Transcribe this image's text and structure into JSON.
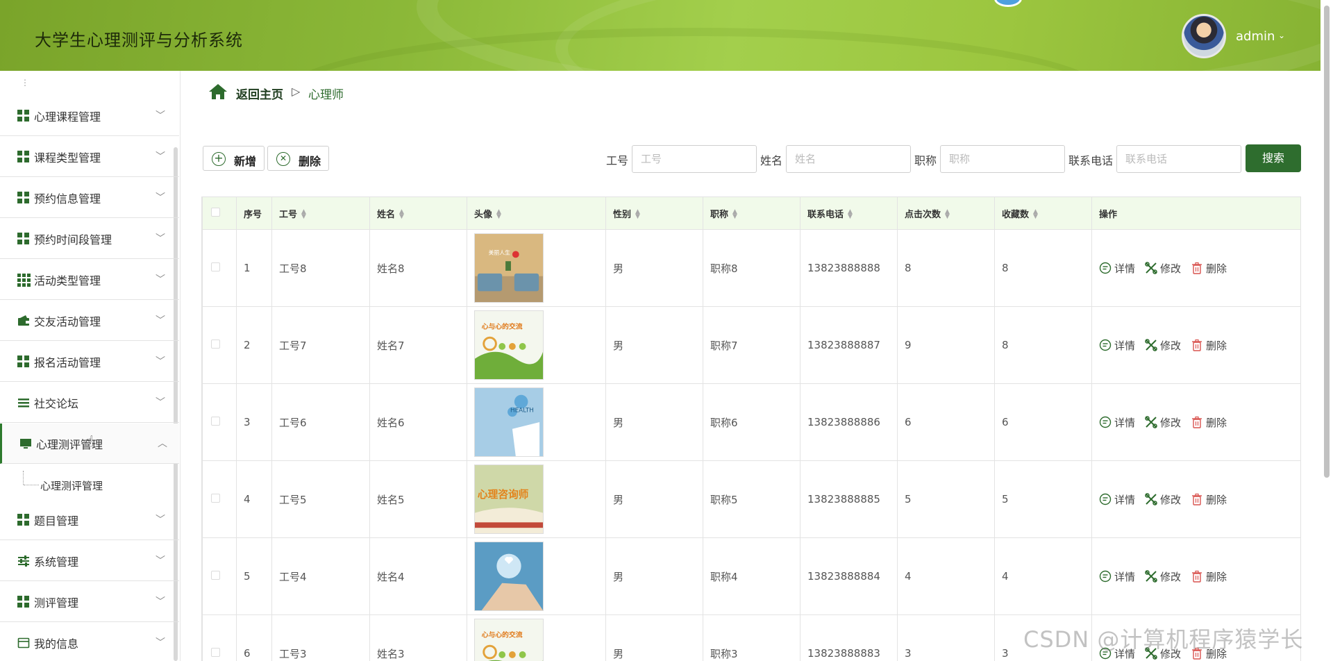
{
  "header": {
    "app_title": "大学生心理测评与分析系统",
    "user_name": "admin",
    "user_caret": "⌄"
  },
  "sidebar": {
    "items": [
      {
        "label": "心理课程管理",
        "icon": "grid-icon",
        "expanded": false
      },
      {
        "label": "课程类型管理",
        "icon": "grid-icon",
        "expanded": false
      },
      {
        "label": "预约信息管理",
        "icon": "grid-icon",
        "expanded": false
      },
      {
        "label": "预约时间段管理",
        "icon": "grid-icon",
        "expanded": false
      },
      {
        "label": "活动类型管理",
        "icon": "grid9-icon",
        "expanded": false
      },
      {
        "label": "交友活动管理",
        "icon": "wallet-icon",
        "expanded": false
      },
      {
        "label": "报名活动管理",
        "icon": "grid-icon",
        "expanded": false
      },
      {
        "label": "社交论坛",
        "icon": "list-icon",
        "expanded": false
      },
      {
        "label": "心理测评管理",
        "icon": "monitor-icon",
        "expanded": true
      },
      {
        "label": "题目管理",
        "icon": "grid-icon",
        "expanded": false
      },
      {
        "label": "系统管理",
        "icon": "sliders-icon",
        "expanded": false
      },
      {
        "label": "测评管理",
        "icon": "grid-icon",
        "expanded": false
      },
      {
        "label": "我的信息",
        "icon": "card-icon",
        "expanded": false
      }
    ],
    "submenu": {
      "label": "心理测评管理"
    }
  },
  "breadcrumb": {
    "home": "返回主页",
    "separator": "▷",
    "current": "心理师"
  },
  "toolbar": {
    "add_label": "新增",
    "delete_label": "删除"
  },
  "search": {
    "fields": [
      {
        "label": "工号",
        "placeholder": "工号",
        "value": ""
      },
      {
        "label": "姓名",
        "placeholder": "姓名",
        "value": ""
      },
      {
        "label": "职称",
        "placeholder": "职称",
        "value": ""
      },
      {
        "label": "联系电话",
        "placeholder": "联系电话",
        "value": ""
      }
    ],
    "button_label": "搜索"
  },
  "table": {
    "columns": [
      "序号",
      "工号",
      "姓名",
      "头像",
      "性别",
      "职称",
      "联系电话",
      "点击次数",
      "收藏数",
      "操作"
    ],
    "actions": {
      "detail": "详情",
      "edit": "修改",
      "delete": "删除"
    },
    "rows": [
      {
        "index": "1",
        "id": "工号8",
        "name": "姓名8",
        "avatar": "room",
        "gender": "男",
        "title": "职称8",
        "phone": "13823888888",
        "clicks": "8",
        "favorites": "8"
      },
      {
        "index": "2",
        "id": "工号7",
        "name": "姓名7",
        "avatar": "green-banner",
        "gender": "男",
        "title": "职称7",
        "phone": "13823888887",
        "clicks": "9",
        "favorites": "8"
      },
      {
        "index": "3",
        "id": "工号6",
        "name": "姓名6",
        "avatar": "health",
        "gender": "男",
        "title": "职称6",
        "phone": "13823888886",
        "clicks": "6",
        "favorites": "6"
      },
      {
        "index": "4",
        "id": "工号5",
        "name": "姓名5",
        "avatar": "counselor",
        "gender": "男",
        "title": "职称5",
        "phone": "13823888885",
        "clicks": "5",
        "favorites": "5"
      },
      {
        "index": "5",
        "id": "工号4",
        "name": "姓名4",
        "avatar": "heart-hand",
        "gender": "男",
        "title": "职称4",
        "phone": "13823888884",
        "clicks": "4",
        "favorites": "4"
      },
      {
        "index": "6",
        "id": "工号3",
        "name": "姓名3",
        "avatar": "green-banner",
        "gender": "男",
        "title": "职称3",
        "phone": "13823888883",
        "clicks": "3",
        "favorites": "3"
      }
    ],
    "image_text": {
      "room": "美丽人生",
      "green-banner": "心与心的交流",
      "health": "HEALTH",
      "counselor": "心理咨询师"
    }
  },
  "watermark": "CSDN @计算机程序猿学长",
  "colors": {
    "primary": "#2e6d2e",
    "header": "#8bb838",
    "table_header": "#f1faea"
  }
}
